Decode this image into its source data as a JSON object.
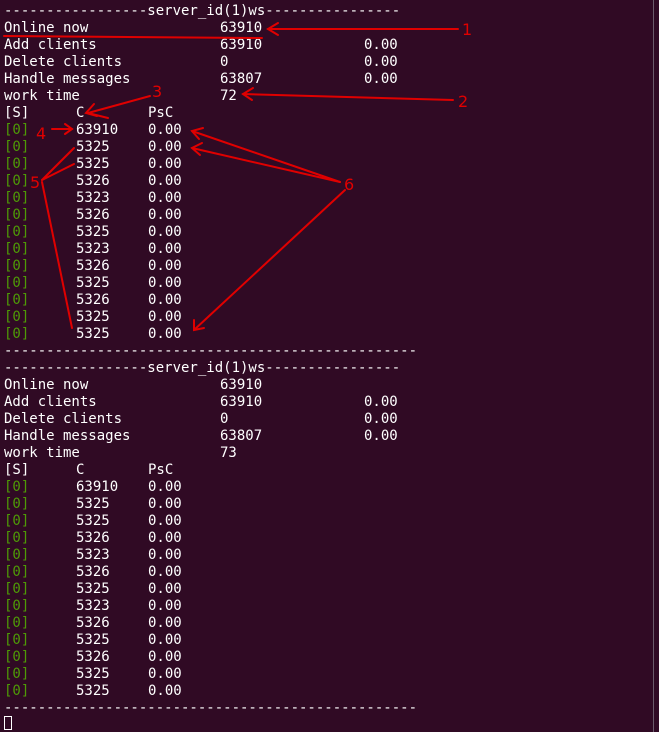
{
  "blocks": [
    {
      "header": "-----------------server_id(1)ws----------------",
      "stats": [
        {
          "label": "Online now",
          "value": "63910",
          "rate": ""
        },
        {
          "label": "Add clients",
          "value": "63910",
          "rate": "0.00"
        },
        {
          "label": "Delete clients",
          "value": "0",
          "rate": "0.00"
        },
        {
          "label": "Handle messages",
          "value": "63807",
          "rate": "0.00"
        },
        {
          "label": "work time",
          "value": "72",
          "rate": ""
        }
      ],
      "table_header": {
        "s": "[S]",
        "c": "C",
        "psc": "PsC"
      },
      "rows": [
        {
          "s": "[0]",
          "c": "63910",
          "psc": "0.00"
        },
        {
          "s": "[0]",
          "c": "5325",
          "psc": "0.00"
        },
        {
          "s": "[0]",
          "c": "5325",
          "psc": "0.00"
        },
        {
          "s": "[0]",
          "c": "5326",
          "psc": "0.00"
        },
        {
          "s": "[0]",
          "c": "5323",
          "psc": "0.00"
        },
        {
          "s": "[0]",
          "c": "5326",
          "psc": "0.00"
        },
        {
          "s": "[0]",
          "c": "5325",
          "psc": "0.00"
        },
        {
          "s": "[0]",
          "c": "5323",
          "psc": "0.00"
        },
        {
          "s": "[0]",
          "c": "5326",
          "psc": "0.00"
        },
        {
          "s": "[0]",
          "c": "5325",
          "psc": "0.00"
        },
        {
          "s": "[0]",
          "c": "5326",
          "psc": "0.00"
        },
        {
          "s": "[0]",
          "c": "5325",
          "psc": "0.00"
        },
        {
          "s": "[0]",
          "c": "5325",
          "psc": "0.00"
        }
      ],
      "footer": "-------------------------------------------------"
    },
    {
      "header": "-----------------server_id(1)ws----------------",
      "stats": [
        {
          "label": "Online now",
          "value": "63910",
          "rate": ""
        },
        {
          "label": "Add clients",
          "value": "63910",
          "rate": "0.00"
        },
        {
          "label": "Delete clients",
          "value": "0",
          "rate": "0.00"
        },
        {
          "label": "Handle messages",
          "value": "63807",
          "rate": "0.00"
        },
        {
          "label": "work time",
          "value": "73",
          "rate": ""
        }
      ],
      "table_header": {
        "s": "[S]",
        "c": "C",
        "psc": "PsC"
      },
      "rows": [
        {
          "s": "[0]",
          "c": "63910",
          "psc": "0.00"
        },
        {
          "s": "[0]",
          "c": "5325",
          "psc": "0.00"
        },
        {
          "s": "[0]",
          "c": "5325",
          "psc": "0.00"
        },
        {
          "s": "[0]",
          "c": "5326",
          "psc": "0.00"
        },
        {
          "s": "[0]",
          "c": "5323",
          "psc": "0.00"
        },
        {
          "s": "[0]",
          "c": "5326",
          "psc": "0.00"
        },
        {
          "s": "[0]",
          "c": "5325",
          "psc": "0.00"
        },
        {
          "s": "[0]",
          "c": "5323",
          "psc": "0.00"
        },
        {
          "s": "[0]",
          "c": "5326",
          "psc": "0.00"
        },
        {
          "s": "[0]",
          "c": "5325",
          "psc": "0.00"
        },
        {
          "s": "[0]",
          "c": "5326",
          "psc": "0.00"
        },
        {
          "s": "[0]",
          "c": "5325",
          "psc": "0.00"
        },
        {
          "s": "[0]",
          "c": "5325",
          "psc": "0.00"
        }
      ],
      "footer": "-------------------------------------------------"
    }
  ],
  "annotations": {
    "n1": "1",
    "n2": "2",
    "n3": "3",
    "n4": "4",
    "n5": "5",
    "n6": "6"
  },
  "colors": {
    "background": "#300a24",
    "text": "#ffffff",
    "slot": "#4e9a06",
    "annotation": "#e00000"
  }
}
